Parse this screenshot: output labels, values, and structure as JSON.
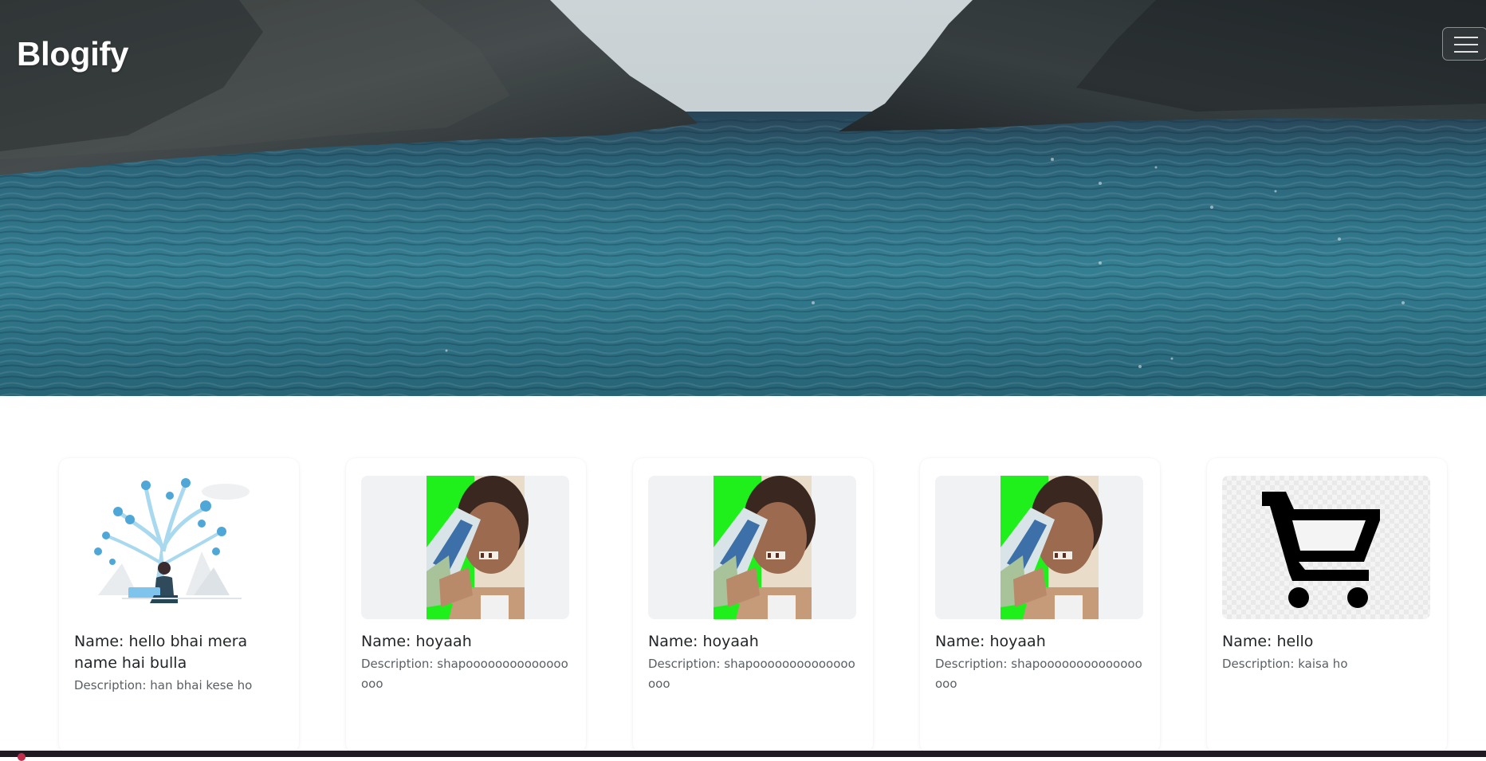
{
  "header": {
    "brand": "Blogify",
    "menu_icon": "hamburger-menu-icon"
  },
  "posts": [
    {
      "name": "Name: hello bhai mera name hai bulla",
      "description": "Description: han bhai kese ho",
      "image": "social-media-tree-illustration"
    },
    {
      "name": "Name: hoyaah",
      "description": "Description: shapooooooooooooooooo",
      "image": "person-holding-shampoo-photo"
    },
    {
      "name": "Name: hoyaah",
      "description": "Description: shapooooooooooooooooo",
      "image": "person-holding-shampoo-photo"
    },
    {
      "name": "Name: hoyaah",
      "description": "Description: shapooooooooooooooooo",
      "image": "person-holding-shampoo-photo"
    },
    {
      "name": "Name: hello",
      "description": "Description: kaisa ho",
      "image": "shopping-cart-icon"
    }
  ],
  "colors": {
    "brand_text": "#ffffff",
    "card_title": "#222629",
    "card_desc": "#5a5f64",
    "water": "#2f7f93"
  }
}
